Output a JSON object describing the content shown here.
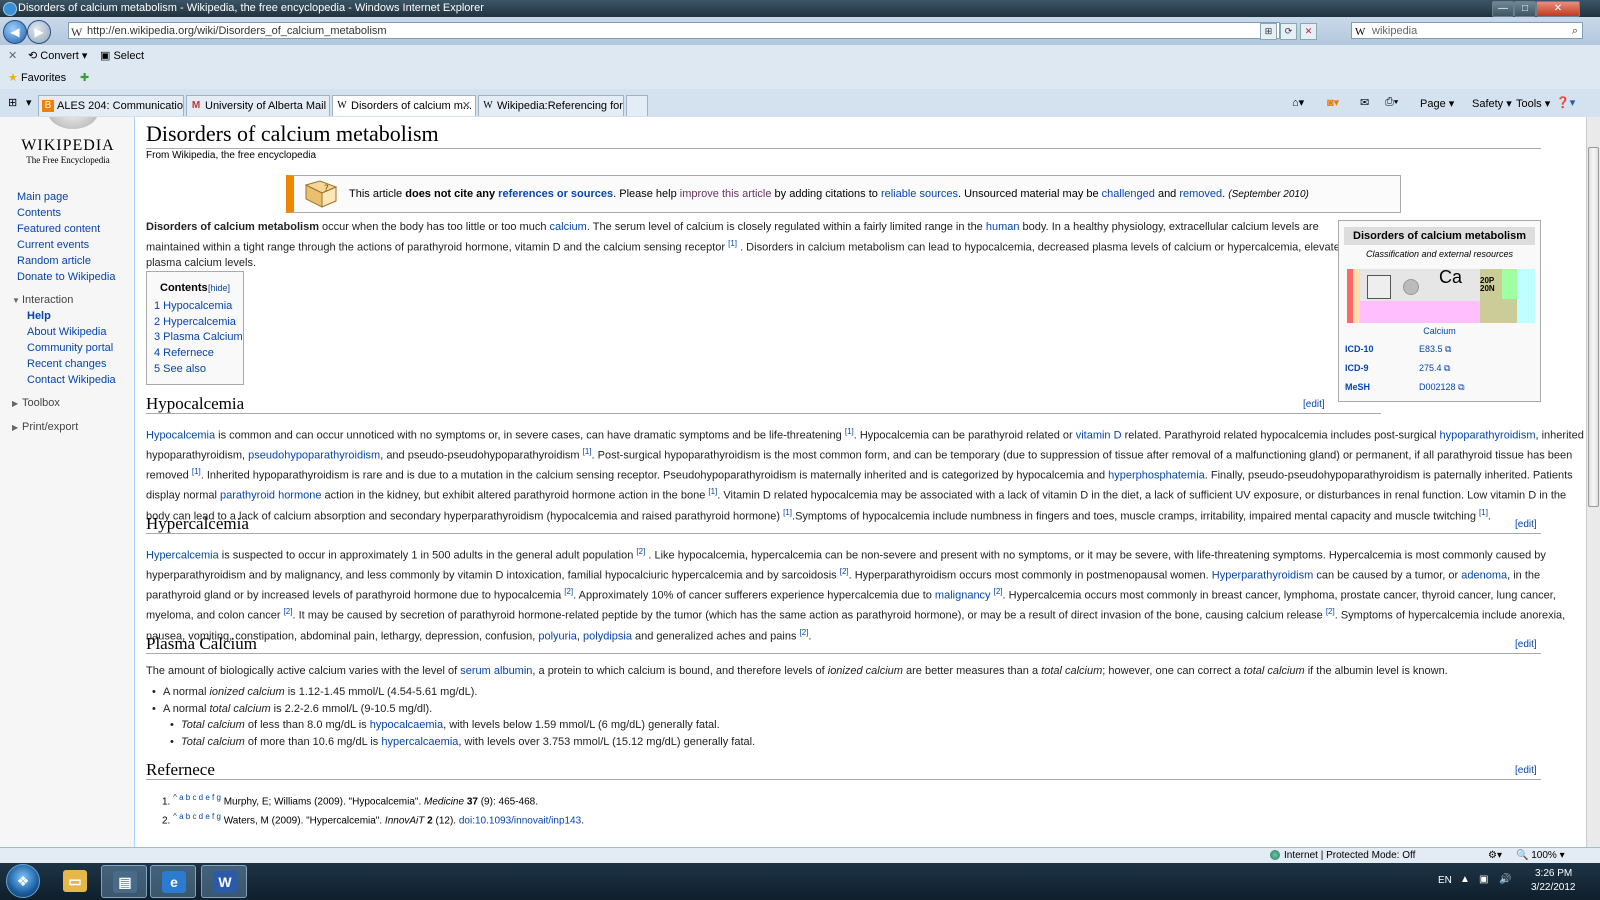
{
  "window": {
    "title": "Disorders of calcium metabolism - Wikipedia, the free encyclopedia - Windows Internet Explorer"
  },
  "address": {
    "url": "http://en.wikipedia.org/wiki/Disorders_of_calcium_metabolism",
    "search_value": "wikipedia"
  },
  "command_bar": {
    "convert": "Convert",
    "select": "Select"
  },
  "favorites_bar": {
    "label": "Favorites"
  },
  "tabs": [
    {
      "label": "ALES 204: Communication...",
      "icon": "blogger-icon"
    },
    {
      "label": "University of Alberta Mail -...",
      "icon": "gmail-icon"
    },
    {
      "label": "Disorders of calcium m...",
      "icon": "wikipedia-icon",
      "active": true
    },
    {
      "label": "Wikipedia:Referencing for ...",
      "icon": "wikipedia-icon"
    }
  ],
  "toolbar_right": {
    "page": "Page",
    "safety": "Safety",
    "tools": "Tools"
  },
  "sidebar": {
    "logo_word": "WIKIPEDIA",
    "logo_tagline": "The Free Encyclopedia",
    "nav": [
      "Main page",
      "Contents",
      "Featured content",
      "Current events",
      "Random article",
      "Donate to Wikipedia"
    ],
    "interaction_head": "Interaction",
    "interaction": [
      "Help",
      "About Wikipedia",
      "Community portal",
      "Recent changes",
      "Contact Wikipedia"
    ],
    "toolbox": "Toolbox",
    "print_export": "Print/export"
  },
  "article": {
    "title": "Disorders of calcium metabolism",
    "tagline": "From Wikipedia, the free encyclopedia",
    "ambox": {
      "t1": "This article ",
      "t2": "does not cite any",
      "t3": "references or sources",
      "t4": ". Please help ",
      "t5": "improve this article",
      "t6": " by adding citations to ",
      "t7": "reliable sources",
      "t8": ". Unsourced material may be ",
      "t9": "challenged",
      "t10": " and ",
      "t11": "removed",
      "t12": ". ",
      "date": "(September 2010)"
    },
    "intro": [
      "<b>Disorders of calcium metabolism</b> occur when the body has too little or too much <a>calcium</a>. The serum level of calcium is closely regulated within a fairly limited range in the <a>human</a> body. In a healthy physiology, extracellular calcium levels are",
      "maintained within a tight range through the actions of parathyroid hormone, vitamin D and the calcium sensing receptor <sup>[1]</sup> . Disorders in calcium metabolism can lead to hypocalcemia, decreased plasma levels of calcium or hypercalcemia, elevated",
      "plasma calcium levels."
    ],
    "toc": {
      "title": "Contents",
      "hide": "[hide]",
      "items": [
        "1 Hypocalcemia",
        "2 Hypercalcemia",
        "3 Plasma Calcium",
        "4 Refernece",
        "5 See also"
      ]
    },
    "edit_label": "[edit]",
    "sections": [
      {
        "heading": "Hypocalcemia",
        "lines": [
          "<a>Hypocalcemia</a> is common and can occur unnoticed with no symptoms or, in severe cases, can have dramatic symptoms and be life-threatening <sup>[1]</sup>. Hypocalcemia can be parathyroid related or <a>vitamin D</a> related. Parathyroid related hypocalcemia includes post-surgical <a>hypoparathyroidism</a>, inherited",
          "hypoparathyroidism, <a>pseudohypoparathyroidism</a>, and pseudo-pseudohypoparathyroidism <sup>[1]</sup>. Post-surgical hypoparathyroidism is the most common form, and can be temporary (due to suppression of tissue after removal of a malfunctioning gland) or permanent, if all parathyroid tissue has been",
          "removed <sup>[1]</sup>. Inherited hypoparathyroidism is rare and is due to a mutation in the calcium sensing receptor. Pseudohypoparathyroidism is maternally inherited and is categorized by hypocalcemia and <a>hyperphosphatemia</a>. Finally, pseudo-pseudohypoparathyroidism is paternally inherited. Patients",
          "display normal <a>parathyroid hormone</a> action in the kidney, but exhibit altered parathyroid hormone action in the bone <sup>[1]</sup>. Vitamin D related hypocalcemia may be associated with a lack of vitamin D in the diet, a lack of sufficient UV exposure, or disturbances in renal function. Low vitamin D in the",
          "body can lead to a lack of calcium absorption and secondary hyperparathyroidism (hypocalcemia and raised parathyroid hormone) <sup>[1]</sup>.Symptoms of hypocalcemia include numbness in fingers and toes, muscle cramps, irritability, impaired mental capacity and muscle twitching <sup>[1]</sup>."
        ]
      },
      {
        "heading": "Hypercalcemia",
        "lines": [
          "<a>Hypercalcemia</a> is suspected to occur in approximately 1 in 500 adults in the general adult population <sup>[2]</sup> . Like hypocalcemia, hypercalcemia can be non-severe and present with no symptoms, or it may be severe, with life-threatening symptoms. Hypercalcemia is most commonly caused by",
          "hyperparathyroidism and by malignancy, and less commonly by vitamin D intoxication, familial hypocalciuric hypercalcemia and by sarcoidosis <sup>[2]</sup>. Hyperparathyroidism occurs most commonly in postmenopausal women. <a>Hyperparathyroidism</a> can be caused by a tumor, or <a>adenoma</a>, in the",
          "parathyroid gland or by increased levels of parathyroid hormone due to hypocalcemia <sup>[2]</sup>. Approximately 10% of cancer sufferers experience hypercalcemia due to <a>malignancy</a> <sup>[2]</sup>. Hypercalcemia occurs most commonly in breast cancer, lymphoma, prostate cancer, thyroid cancer, lung cancer,",
          "myeloma, and colon cancer <sup>[2]</sup>. It may be caused by secretion of parathyroid hormone-related peptide by the tumor (which has the same action as parathyroid hormone), or may be a result of direct invasion of the bone, causing calcium release <sup>[2]</sup>. Symptoms of hypercalcemia include anorexia,",
          "nausea, vomiting, constipation, abdominal pain, lethargy, depression, confusion, <a>polyuria</a>, <a>polydipsia</a> and generalized aches and pains <sup>[2]</sup>."
        ]
      },
      {
        "heading": "Plasma Calcium",
        "lines": [
          "The amount of biologically active calcium varies with the level of <a>serum albumin</a>, a protein to which calcium is bound, and therefore levels of <i>ionized calcium</i> are better measures than a <i>total calcium</i>; however, one can correct a <i>total calcium</i> if the albumin level is known."
        ]
      },
      {
        "heading": "Refernece"
      }
    ],
    "bullets": [
      "A normal <i>ionized calcium</i> is 1.12-1.45 mmol/L (4.54-5.61 mg/dL).",
      "A normal <i>total calcium</i> is 2.2-2.6 mmol/L (9-10.5 mg/dl).",
      "<i>Total calcium</i> of less than 8.0 mg/dL is <a>hypocalcaemia</a>, with levels below 1.59 mmol/L (6 mg/dL) generally fatal.",
      "<i>Total calcium</i> of more than 10.6 mg/dL is <a>hypercalcaemia</a>, with levels over 3.753 mmol/L (15.12 mg/dL) generally fatal."
    ],
    "references": [
      "1. <sup>^ <a>a b c d e f g</a></sup> Murphy, E; Williams (2009). \"Hypocalcemia\". <i>Medicine</i> <b>37</b> (9): 465-468.",
      "2. <sup>^ <a>a b c d e f g</a></sup> Waters, M (2009). \"Hypercalcemia\". <i>InnovAiT</i> <b>2</b> (12). <a>doi:10.1093/innovait/inp143</a>."
    ]
  },
  "infobox": {
    "title": "Disorders of calcium metabolism",
    "subtitle": "Classification and external resources",
    "element_symbol": "Ca",
    "element_small": "20P 20N",
    "caption": "Calcium",
    "rows": [
      {
        "key": "ICD-10",
        "value": "E83.5"
      },
      {
        "key": "ICD-9",
        "value": "275.4"
      },
      {
        "key": "MeSH",
        "value": "D002128"
      }
    ]
  },
  "status": {
    "zone": "Internet | Protected Mode: Off",
    "zoom": "100%"
  },
  "taskbar": {
    "lang": "EN",
    "time": "3:26 PM",
    "date": "3/22/2012"
  }
}
